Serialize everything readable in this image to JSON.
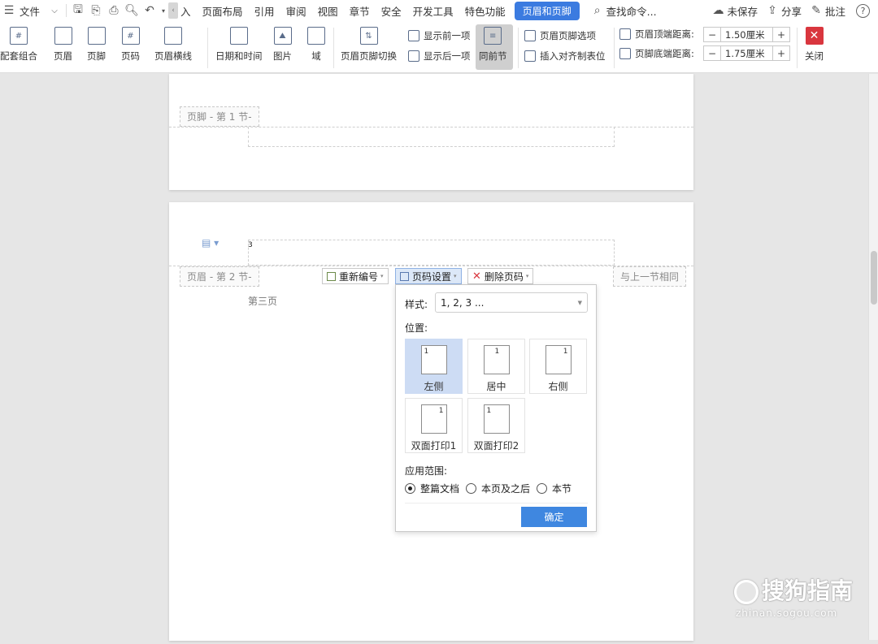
{
  "menubar": {
    "file": "文件",
    "insert_partial": "入",
    "tabs": [
      "页面布局",
      "引用",
      "审阅",
      "视图",
      "章节",
      "安全",
      "开发工具",
      "特色功能"
    ],
    "active_tab": "页眉和页脚",
    "search": "查找命令...",
    "unsaved": "未保存",
    "share": "分享",
    "comment": "批注",
    "help": "?"
  },
  "ribbon": {
    "combo": "配套组合",
    "header": "页眉",
    "footer": "页脚",
    "page_number": "页码",
    "header_line": "页眉横线",
    "date_time": "日期和时间",
    "picture": "图片",
    "field": "域",
    "switch": "页眉页脚切换",
    "show_prev": "显示前一项",
    "show_next": "显示后一项",
    "same_as_prev": "同前节",
    "hf_options": "页眉页脚选项",
    "insert_align_tab": "插入对齐制表位",
    "header_top_label": "页眉顶端距离:",
    "header_top_value": "1.50厘米",
    "footer_bottom_label": "页脚底端距离:",
    "footer_bottom_value": "1.75厘米",
    "close": "关闭"
  },
  "doc": {
    "page1_footer_tag": "页脚 - 第 1 节-",
    "page2_header_tag": "页眉 - 第 2 节-",
    "same_as_prev_tag": "与上一节相同",
    "header_number": "3",
    "body_text": "第三页",
    "toolbar": {
      "renumber": "重新编号",
      "page_setup": "页码设置",
      "delete": "删除页码"
    }
  },
  "popup": {
    "style_label": "样式:",
    "style_value": "1, 2, 3 ...",
    "position_label": "位置:",
    "positions": [
      {
        "label": "左侧",
        "num": "1"
      },
      {
        "label": "居中",
        "num": "1"
      },
      {
        "label": "右侧",
        "num": "1"
      },
      {
        "label": "双面打印1",
        "num": "1"
      },
      {
        "label": "双面打印2",
        "num": "1"
      }
    ],
    "selected_position": "左侧",
    "scope_label": "应用范围:",
    "scopes": [
      "整篇文档",
      "本页及之后",
      "本节"
    ],
    "selected_scope": "整篇文档",
    "ok": "确定"
  },
  "watermark": {
    "brand": "搜狗指南",
    "url": "zhinan.sogou.com"
  },
  "colors": {
    "accent": "#3b7be0",
    "close": "#d9363e",
    "selection": "#cddcf4"
  }
}
